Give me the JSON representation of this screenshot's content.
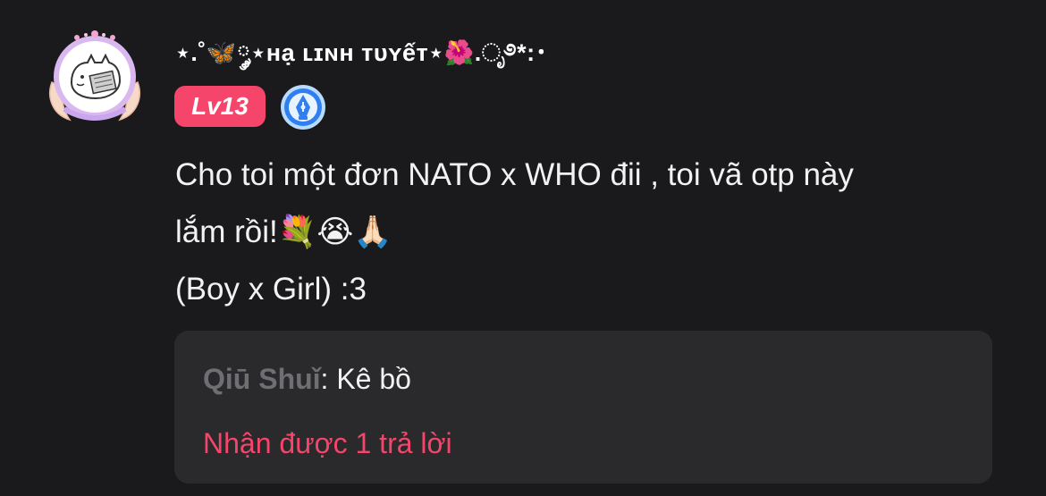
{
  "post": {
    "username": "⋆.˚🦋༘⋆ʜạ ʟɪɴʜ ᴛᴜʏếᴛ⋆🌺.ೃ࿔*:･",
    "level_label": "Lv13",
    "message_lines": [
      "Cho toi một đơn NATO x WHO đii , toi vã otp này",
      "lắm rồi!💐😭🙏🏻",
      "(Boy x Girl) :3"
    ]
  },
  "reply": {
    "author": "Qiū Shuǐ",
    "separator": ": ",
    "text": "Kê bồ",
    "count_label": "Nhận được 1 trả lời"
  },
  "colors": {
    "background": "#1a191b",
    "accent": "#f5456b",
    "reply_box": "#2a292c",
    "muted": "#6f6e72"
  },
  "icons": {
    "avatar": "cat-avatar-with-wings-frame",
    "badge": "fountain-pen-icon"
  }
}
